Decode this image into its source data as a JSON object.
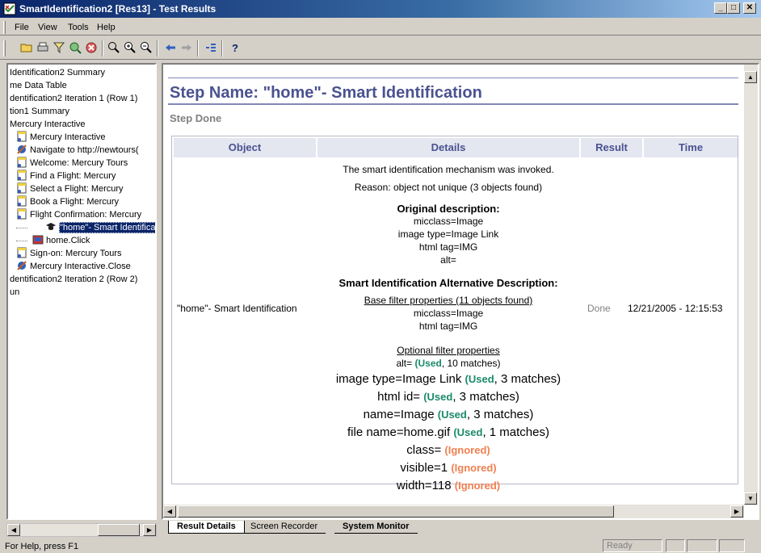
{
  "window": {
    "title": "SmartIdentification2 [Res13] - Test Results",
    "minimize": "_",
    "maximize": "□",
    "close": "✕"
  },
  "menu": [
    "File",
    "View",
    "Tools",
    "Help"
  ],
  "toolbar": {
    "icons": [
      "open-icon",
      "print-icon",
      "filter-icon",
      "find-icon",
      "disconnect-icon",
      "zoom-icon",
      "zoom-in-icon",
      "zoom-out-icon",
      "back-icon",
      "forward-icon",
      "results-icon",
      "help-icon"
    ],
    "help_glyph": "?"
  },
  "tree": {
    "items": [
      {
        "label": "Identification2 Summary",
        "icon": "none"
      },
      {
        "label": "me Data Table",
        "icon": "none"
      },
      {
        "label": "dentification2 Iteration 1 (Row 1)",
        "icon": "none"
      },
      {
        "label": "tion1 Summary",
        "icon": "none"
      },
      {
        "label": "Mercury Interactive",
        "icon": "none"
      },
      {
        "label": "Mercury Interactive",
        "icon": "page-icon"
      },
      {
        "label": "Navigate to http://newtours(",
        "icon": "navigate-icon"
      },
      {
        "label": "Welcome: Mercury Tours",
        "icon": "page-icon"
      },
      {
        "label": "Find a Flight: Mercury",
        "icon": "page-icon"
      },
      {
        "label": "Select a Flight: Mercury",
        "icon": "page-icon"
      },
      {
        "label": "Book a Flight: Mercury",
        "icon": "page-icon"
      },
      {
        "label": "Flight Confirmation: Mercury",
        "icon": "page-icon"
      },
      {
        "label": "\"home\"- Smart Identifica",
        "icon": "smart-id-icon"
      },
      {
        "label": "home.Click",
        "icon": "image-link-icon"
      },
      {
        "label": "Sign-on: Mercury Tours",
        "icon": "page-icon"
      },
      {
        "label": "Mercury Interactive.Close",
        "icon": "navigate-icon"
      },
      {
        "label": "dentification2 Iteration 2 (Row 2)",
        "icon": "none"
      },
      {
        "label": "un",
        "icon": "none"
      }
    ]
  },
  "details": {
    "step_title": "Step Name: \"home\"- Smart Identification",
    "step_status": "Step Done",
    "table": {
      "headers": [
        "Object",
        "Details",
        "Result",
        "Time"
      ],
      "object": "\"home\"- Smart Identification",
      "result": "Done",
      "time": "12/21/2005 - 12:15:53",
      "lines": {
        "invoked": "The smart identification mechanism was invoked.",
        "reason": "Reason: object not unique (3 objects found)",
        "orig_heading": "Original description:",
        "orig_micclass": "micclass=Image",
        "orig_image_type": "image type=Image Link",
        "orig_html_tag": "html tag=IMG",
        "orig_alt": "alt=",
        "alt_heading": "Smart Identification Alternative Description:",
        "base_heading": "Base filter properties (11 objects found)",
        "base_micclass": "micclass=Image",
        "base_html_tag": "html tag=IMG",
        "optional_heading": "Optional filter properties",
        "alt_prefix": "alt= ",
        "alt_suffix": ", 10 matches)",
        "image_type_prefix": "image type=Image Link ",
        "image_type_suffix": ", 3 matches)",
        "html_id_prefix": "html id= ",
        "html_id_suffix": ", 3 matches)",
        "name_prefix": "name=Image ",
        "name_suffix": ", 3 matches)",
        "file_name_prefix": "file name=home.gif ",
        "file_name_suffix": ", 1 matches)",
        "class_prefix": "class= ",
        "visible_prefix": "visible=1 ",
        "width_prefix": "width=118 ",
        "used_tag": "(Used",
        "ignored_tag": "(Ignored)"
      }
    }
  },
  "tabs": [
    "Result Details",
    "Screen Recorder",
    "System Monitor"
  ],
  "status": {
    "help_text": "For Help, press F1",
    "ready": "Ready"
  },
  "colors": {
    "title_blue": "#4a5290",
    "used": "#1a8a6a",
    "ignored": "#f08050",
    "selection": "#0a246a"
  }
}
